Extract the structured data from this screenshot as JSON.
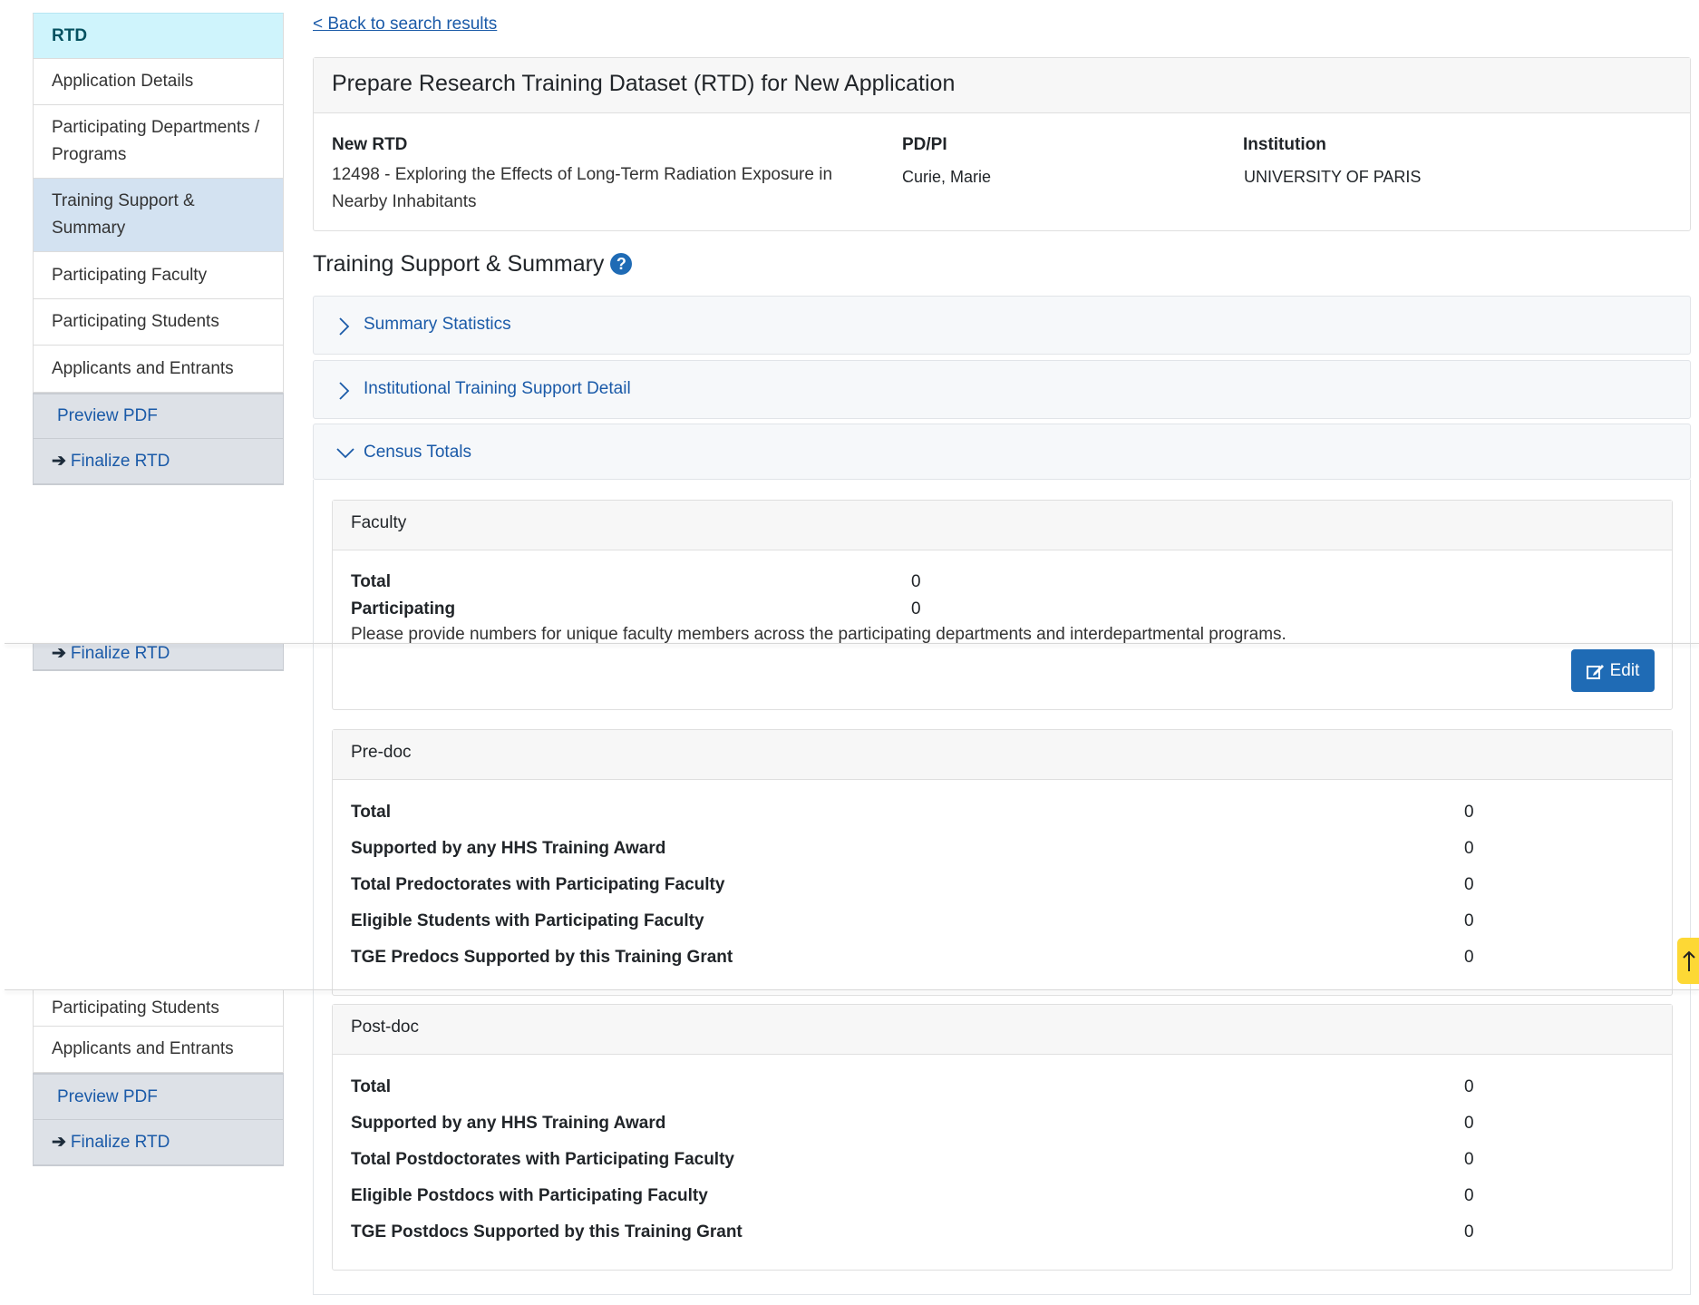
{
  "sidebar": {
    "rtd": "RTD",
    "items": [
      "Application Details",
      "Participating Departments / Programs",
      "Training Support & Summary",
      "Participating Faculty",
      "Participating Students",
      "Applicants and Entrants"
    ],
    "active": "Training Support & Summary",
    "preview_pdf": "Preview PDF",
    "finalize": "Finalize RTD"
  },
  "back_link": "< Back to search results",
  "header": {
    "title": "Prepare Research Training Dataset (RTD) for New Application",
    "new_rtd_label": "New RTD",
    "new_rtd_value": "12498 - Exploring the Effects of Long-Term Radiation Exposure in Nearby Inhabitants",
    "pdpi_label": "PD/PI",
    "pdpi_value": "Curie, Marie",
    "institution_label": "Institution",
    "institution_value": "UNIVERSITY OF PARIS"
  },
  "section_title": "Training Support & Summary",
  "accordion": [
    {
      "label": "Summary Statistics",
      "expanded": false
    },
    {
      "label": "Institutional Training Support Detail",
      "expanded": false
    },
    {
      "label": "Census Totals",
      "expanded": true
    }
  ],
  "faculty": {
    "title": "Faculty",
    "rows": [
      {
        "label": "Total",
        "value": "0"
      },
      {
        "label": "Participating",
        "value": "0"
      }
    ],
    "note": "Please provide numbers for unique faculty members across the participating departments and interdepartmental programs.",
    "edit": "Edit"
  },
  "predoc": {
    "title": "Pre-doc",
    "rows": [
      {
        "label": "Total",
        "value": "0"
      },
      {
        "label": "Supported by any HHS Training Award",
        "value": "0"
      },
      {
        "label": "Total Predoctorates with Participating Faculty",
        "value": "0"
      },
      {
        "label": "Eligible Students with Participating Faculty",
        "value": "0"
      },
      {
        "label": "TGE Predocs Supported by this Training Grant",
        "value": "0"
      }
    ]
  },
  "postdoc": {
    "title": "Post-doc",
    "rows": [
      {
        "label": "Total",
        "value": "0"
      },
      {
        "label": "Supported by any HHS Training Award",
        "value": "0"
      },
      {
        "label": "Total Postdoctorates with Participating Faculty",
        "value": "0"
      },
      {
        "label": "Eligible Postdocs with Participating Faculty",
        "value": "0"
      },
      {
        "label": "TGE Postdocs Supported by this Training Grant",
        "value": "0"
      }
    ]
  },
  "colors": {
    "link": "#1a5aa8",
    "rtd_bg": "#cff4fc",
    "active_bg": "#d3e2f1",
    "edit_button": "#1f6bb5",
    "back_to_top": "#fdd835"
  }
}
